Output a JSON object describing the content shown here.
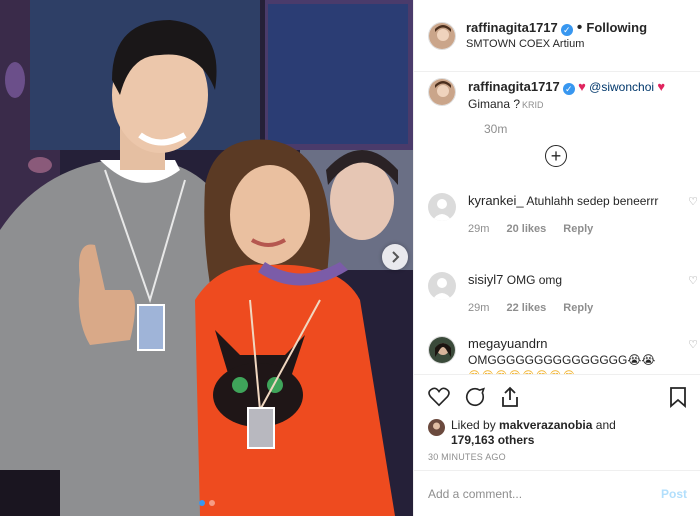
{
  "post": {
    "author": "raffinagita1717",
    "follow_state": "Following",
    "location": "SMTOWN COEX Artium",
    "verified_icon": "verified-badge-icon"
  },
  "caption": {
    "author": "raffinagita1717",
    "mention": "@siwonchoi",
    "text": "Gimana ?",
    "watermark": "KRID",
    "time": "30m"
  },
  "comments": [
    {
      "user": "kyrankei_",
      "text": "Atuhlahh sedep beneerrr",
      "age": "29m",
      "likes": "20 likes",
      "reply": "Reply"
    },
    {
      "user": "sisiyl7",
      "text": "OMG omg",
      "age": "29m",
      "likes": "22 likes",
      "reply": "Reply"
    },
    {
      "user": "megayuandrn",
      "text": "OMGGGGGGGGGGGGGGG😭😭",
      "emojis": "😍😍😍😍😍😍😍😍"
    }
  ],
  "likes": {
    "prefix": "Liked by",
    "user": "makverazanobia",
    "and": "and",
    "count": "179,163 others",
    "timestamp": "30 MINUTES AGO"
  },
  "add_comment": {
    "placeholder": "Add a comment...",
    "post_label": "Post"
  },
  "colors": {
    "accent": "#3897f0",
    "heart": "#e0245e",
    "post_disabled": "#b2dffc",
    "muted": "#8e8e8e"
  },
  "carousel": {
    "slide": 1,
    "total": 2
  }
}
